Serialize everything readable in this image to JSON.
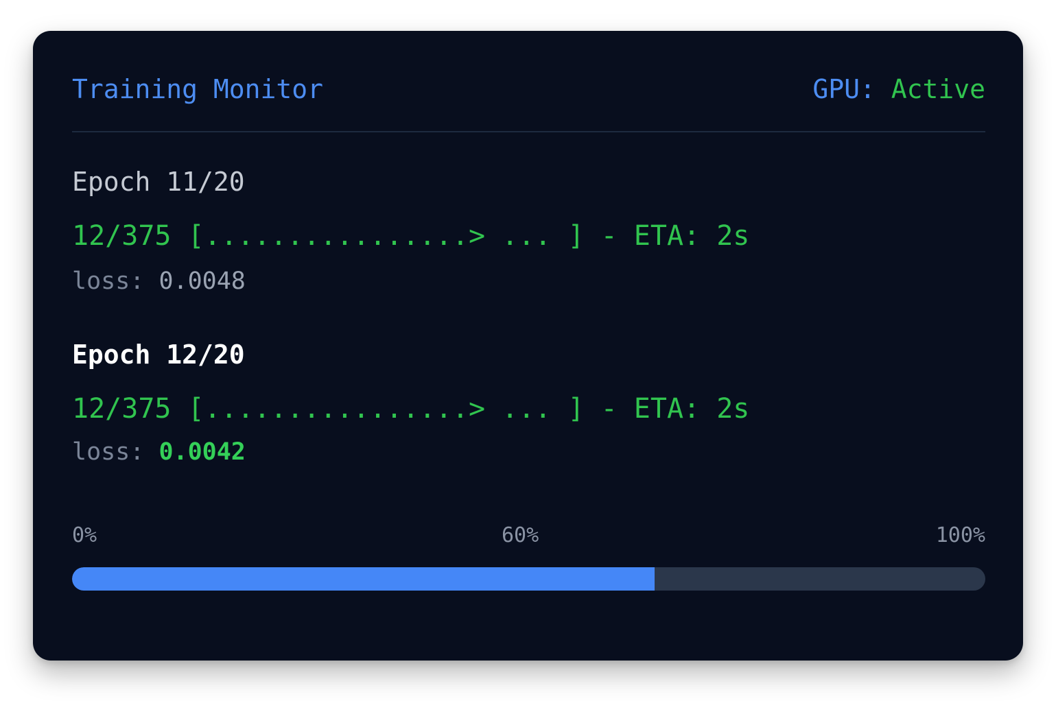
{
  "header": {
    "title": "Training Monitor",
    "gpu_label": "GPU: ",
    "gpu_status": "Active"
  },
  "epochs": [
    {
      "heading": "Epoch 11/20",
      "progress_line": "12/375 [................> ... ] - ETA: 2s",
      "loss_label": "loss: ",
      "loss_value": "0.0048"
    },
    {
      "heading": "Epoch 12/20",
      "progress_line": "12/375 [................> ... ] - ETA: 2s",
      "loss_label": "loss: ",
      "loss_value": "0.0042"
    }
  ],
  "progress": {
    "scale_start": "0%",
    "scale_mid": "60%",
    "scale_end": "100%",
    "fraction": 0.638
  },
  "colors": {
    "background": "#080e1e",
    "accent_blue": "#4587f7",
    "accent_green": "#31c44f",
    "track": "#2b374b"
  }
}
